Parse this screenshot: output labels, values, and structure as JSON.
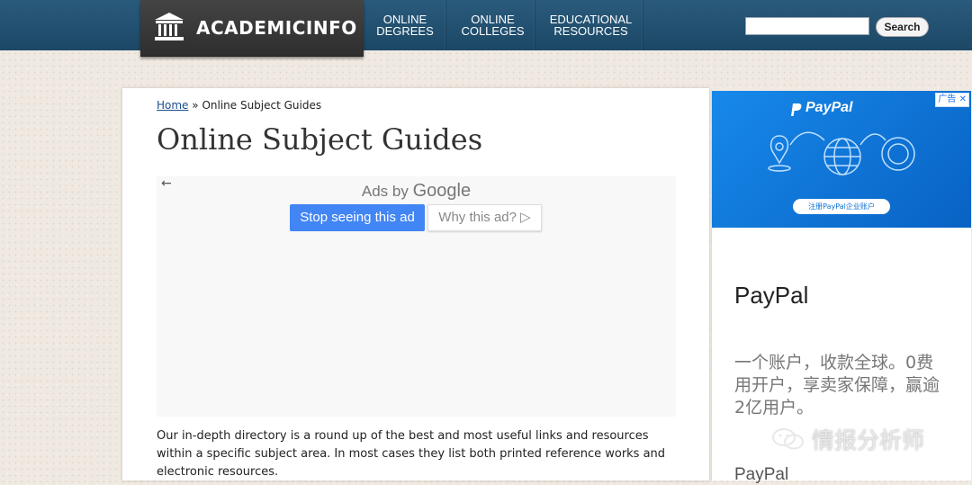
{
  "header": {
    "logo_text": "ACADEMICINFO",
    "nav": [
      {
        "line1": "ONLINE",
        "line2": "DEGREES"
      },
      {
        "line1": "ONLINE",
        "line2": "COLLEGES"
      },
      {
        "line1": "EDUCATIONAL",
        "line2": "RESOURCES"
      }
    ],
    "search_button": "Search",
    "search_value": ""
  },
  "breadcrumb": {
    "home": "Home",
    "separator": "»",
    "current": "Online Subject Guides"
  },
  "page_title": "Online Subject Guides",
  "ad_frame": {
    "back_arrow": "←",
    "ads_by": "Ads by",
    "google": "Google",
    "stop_button": "Stop seeing this ad",
    "why_button": "Why this ad?",
    "why_icon": "▷"
  },
  "body_text": "Our in-depth directory is a round up of the best and most useful links and resources within a specific subject area. In most cases they list both printed reference works and electronic resources.",
  "side_ad": {
    "badge": "广告",
    "close": "✕",
    "brand": "PayPal",
    "cta": "注册PayPal企业账户",
    "title": "PayPal",
    "description": "一个账户，收款全球。0费用开户，享卖家保障，赢逾2亿用户。",
    "title2": "PayPal"
  },
  "watermark": "情报分析师",
  "colors": {
    "header_blue": "#1f4e6e",
    "ad_blue": "#4285f4",
    "paypal_blue": "#0a6fd6"
  }
}
